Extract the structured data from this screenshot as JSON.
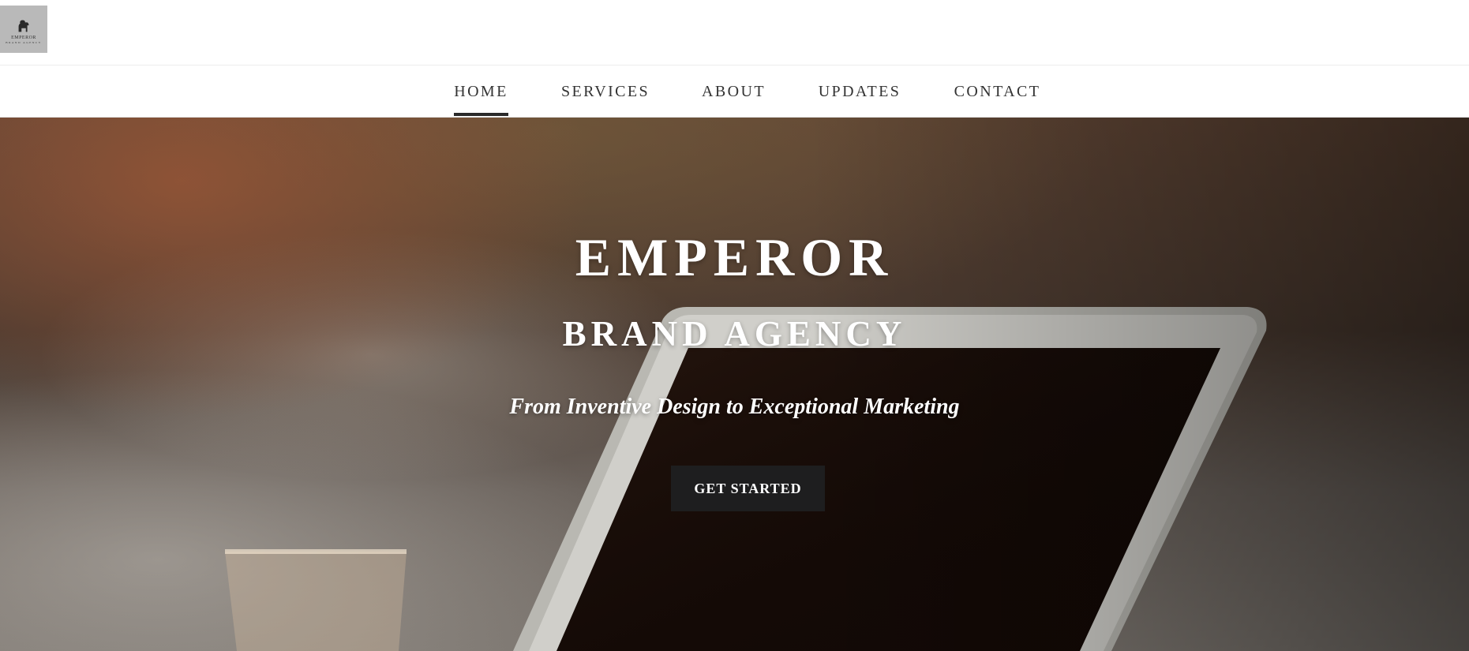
{
  "logo": {
    "name": "EMPEROR",
    "sub": "BRAND AGENCY",
    "icon": "lion-icon"
  },
  "nav": {
    "items": [
      {
        "label": "HOME",
        "active": true
      },
      {
        "label": "SERVICES",
        "active": false
      },
      {
        "label": "ABOUT",
        "active": false
      },
      {
        "label": "UPDATES",
        "active": false
      },
      {
        "label": "CONTACT",
        "active": false
      }
    ]
  },
  "hero": {
    "title": "EMPEROR",
    "subtitle": "BRAND AGENCY",
    "tagline": "From Inventive Design to Exceptional Marketing",
    "cta_label": "GET STARTED"
  },
  "colors": {
    "nav_text": "#333333",
    "button_bg": "#1e1e1f",
    "hero_text": "#ffffff"
  }
}
